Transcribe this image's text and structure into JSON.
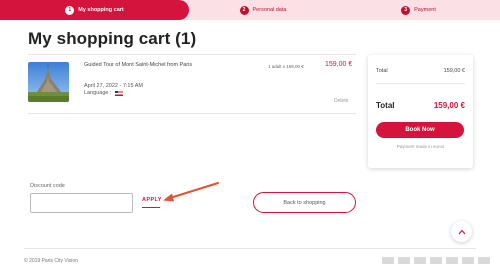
{
  "steps": [
    {
      "num": "1",
      "label": "My shopping cart"
    },
    {
      "num": "2",
      "label": "Personal data"
    },
    {
      "num": "3",
      "label": "Payment"
    }
  ],
  "page_title": "My shopping cart (1)",
  "cart_item": {
    "title": "Guided Tour of Mont Saint-Michel from Paris",
    "date": "April 27, 2022 - 7:15 AM",
    "language_label": "Language :",
    "quantity": "1 adult x 159,00 €",
    "price": "159,00 €",
    "delete_label": "Delete"
  },
  "summary": {
    "total_label": "Total",
    "total_value": "159,00 €",
    "grand_total_label": "Total",
    "grand_total_value": "159,00 €",
    "book_button": "Book Now",
    "payment_note": "Payment made in euros"
  },
  "discount": {
    "label": "Discount code",
    "placeholder": "",
    "apply_label": "APPLY"
  },
  "back_button": "Back to shopping",
  "footer": {
    "copyright": "© 2019 Paris City Vision",
    "payment_icons": [
      "visa-icon",
      "mastercard-icon",
      "maestro-icon",
      "amex-icon",
      "card-icon",
      "bank-icon",
      "paypal-icon"
    ]
  },
  "colors": {
    "brand": "#d4143c",
    "step_inactive_bg": "#fbe0e6"
  }
}
